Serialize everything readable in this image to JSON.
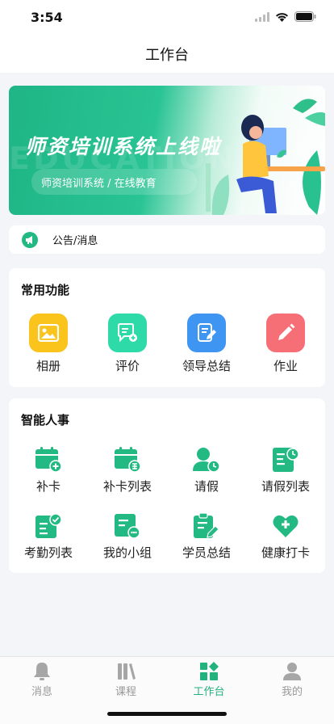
{
  "status_bar": {
    "time": "3:54"
  },
  "nav": {
    "title": "工作台"
  },
  "banner": {
    "title": "师资培训系统上线啦",
    "watermark": "EDUCATION",
    "subtitle": "师资培训系统  /  在线教育"
  },
  "notice": {
    "label": "公告/消息",
    "icon": "megaphone-icon"
  },
  "common": {
    "title": "常用功能",
    "items": [
      {
        "label": "相册",
        "icon": "album-icon",
        "color": "#f9c51c"
      },
      {
        "label": "评价",
        "icon": "evaluate-icon",
        "color": "#2ed9a8"
      },
      {
        "label": "领导总结",
        "icon": "summary-icon",
        "color": "#3c95f2"
      },
      {
        "label": "作业",
        "icon": "pencil-icon",
        "color": "#f66e76"
      }
    ]
  },
  "hr": {
    "title": "智能人事",
    "items": [
      {
        "label": "补卡",
        "icon": "calendar-add-icon"
      },
      {
        "label": "补卡列表",
        "icon": "calendar-list-icon"
      },
      {
        "label": "请假",
        "icon": "person-clock-icon"
      },
      {
        "label": "请假列表",
        "icon": "doc-clock-icon"
      },
      {
        "label": "考勤列表",
        "icon": "doc-check-icon"
      },
      {
        "label": "我的小组",
        "icon": "group-chat-icon"
      },
      {
        "label": "学员总结",
        "icon": "clipboard-edit-icon"
      },
      {
        "label": "健康打卡",
        "icon": "heart-plus-icon"
      }
    ],
    "accent": "#23b983"
  },
  "tabs": [
    {
      "label": "消息",
      "icon": "bell-icon",
      "active": false
    },
    {
      "label": "课程",
      "icon": "books-icon",
      "active": false
    },
    {
      "label": "工作台",
      "icon": "workbench-icon",
      "active": true
    },
    {
      "label": "我的",
      "icon": "user-icon",
      "active": false
    }
  ]
}
